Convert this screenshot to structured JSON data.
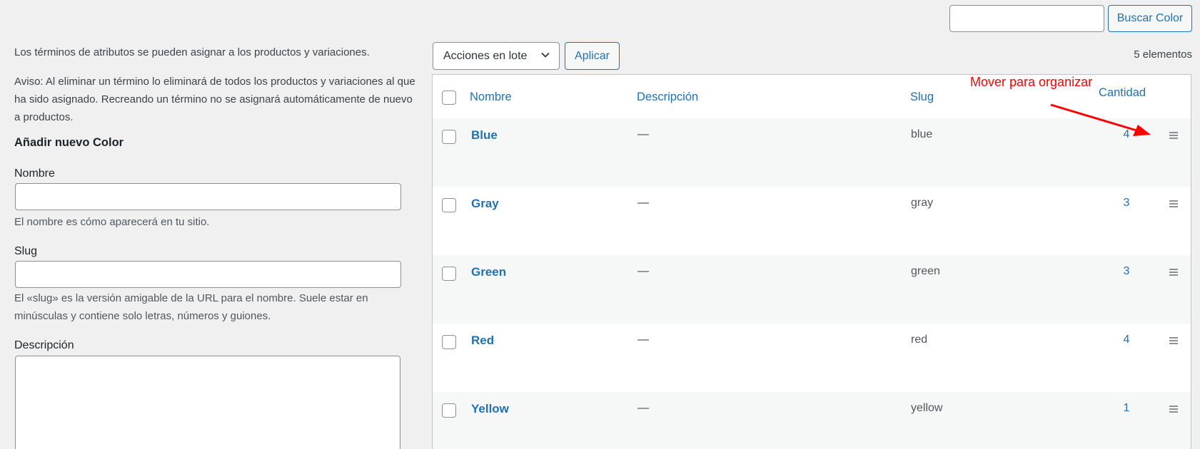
{
  "search": {
    "placeholder": "",
    "button_label": "Buscar Color"
  },
  "form": {
    "intro": "Los términos de atributos se pueden asignar a los productos y variaciones.",
    "notice": "Aviso: Al eliminar un término lo eliminará de todos los productos y variaciones al que ha sido asignado. Recreando un término no se asignará automáticamente de nuevo a productos.",
    "heading": "Añadir nuevo Color",
    "name_label": "Nombre",
    "name_hint": "El nombre es cómo aparecerá en tu sitio.",
    "slug_label": "Slug",
    "slug_hint": "El «slug» es la versión amigable de la URL para el nombre. Suele estar en minúsculas y contiene solo letras, números y guiones.",
    "description_label": "Descripción"
  },
  "toolbar": {
    "bulk_actions": "Acciones en lote",
    "apply_label": "Aplicar",
    "items_count": "5 elementos"
  },
  "table": {
    "headers": {
      "name": "Nombre",
      "description": "Descripción",
      "slug": "Slug",
      "count": "Cantidad"
    },
    "rows": [
      {
        "name": "Blue",
        "description": "—",
        "slug": "blue",
        "count": "4"
      },
      {
        "name": "Gray",
        "description": "—",
        "slug": "gray",
        "count": "3"
      },
      {
        "name": "Green",
        "description": "—",
        "slug": "green",
        "count": "3"
      },
      {
        "name": "Red",
        "description": "—",
        "slug": "red",
        "count": "4"
      },
      {
        "name": "Yellow",
        "description": "—",
        "slug": "yellow",
        "count": "1"
      }
    ]
  },
  "annotation": {
    "text": "Mover para organizar",
    "color": "#ff0000"
  },
  "colors": {
    "accent": "#2271b1",
    "background": "#f0f0f1",
    "row_alt": "#f6f7f7"
  }
}
